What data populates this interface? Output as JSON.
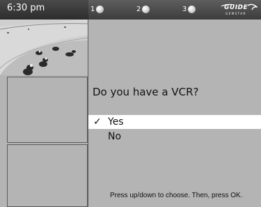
{
  "topbar": {
    "time": "6:30 pm",
    "channels": [
      {
        "label": "1"
      },
      {
        "label": "2"
      },
      {
        "label": "3"
      }
    ],
    "logo": {
      "word": "GUIDE",
      "sub": "GEMSTAR"
    }
  },
  "video": {
    "icon": "motorcycle-race-video-icon"
  },
  "dialog": {
    "question": "Do you have a VCR?",
    "options": [
      {
        "label": "Yes",
        "selected": true,
        "mark": "✓"
      },
      {
        "label": "No",
        "selected": false
      }
    ],
    "hint": "Press up/down to choose. Then, press OK."
  },
  "colors": {
    "background": "#b4b4b4",
    "topbar": "#4a4a4a",
    "selection": "#ffffff"
  }
}
